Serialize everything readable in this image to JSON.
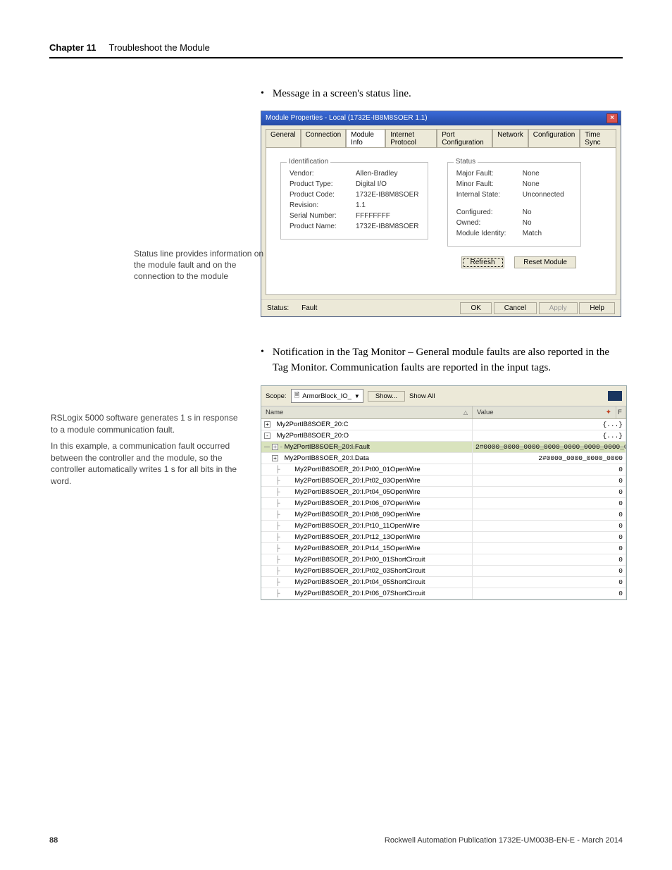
{
  "header": {
    "chapter": "Chapter 11",
    "title": "Troubleshoot the Module"
  },
  "bullets": {
    "b1": "Message in a screen's status line.",
    "b2": "Notification in the Tag Monitor – General module faults are also reported in the Tag Monitor. Communication faults are reported in the input tags."
  },
  "callouts": {
    "c1": "Status line provides information on the module fault and on the connection to the module",
    "c2a": "RSLogix 5000 software generates 1 s in response to a module communication fault.",
    "c2b": "In this example, a communication fault occurred between the controller and the module, so the controller automatically writes 1 s for all bits in the word."
  },
  "dialog": {
    "title": "Module Properties - Local (1732E-IB8M8SOER 1.1)",
    "tabs": [
      "General",
      "Connection",
      "Module Info",
      "Internet Protocol",
      "Port Configuration",
      "Network",
      "Configuration",
      "Time Sync"
    ],
    "ident": {
      "legend": "Identification",
      "vendor_l": "Vendor:",
      "vendor_v": "Allen-Bradley",
      "ptype_l": "Product Type:",
      "ptype_v": "Digital I/O",
      "pcode_l": "Product Code:",
      "pcode_v": "1732E-IB8M8SOER",
      "rev_l": "Revision:",
      "rev_v": "1.1",
      "ser_l": "Serial Number:",
      "ser_v": "FFFFFFFF",
      "pname_l": "Product Name:",
      "pname_v": "1732E-IB8M8SOER"
    },
    "status": {
      "legend": "Status",
      "maj_l": "Major Fault:",
      "maj_v": "None",
      "min_l": "Minor Fault:",
      "min_v": "None",
      "int_l": "Internal State:",
      "int_v": "Unconnected",
      "cfg_l": "Configured:",
      "cfg_v": "No",
      "own_l": "Owned:",
      "own_v": "No",
      "mid_l": "Module Identity:",
      "mid_v": "Match"
    },
    "refresh": "Refresh",
    "reset": "Reset Module",
    "status_l": "Status:",
    "status_v": "Fault",
    "ok": "OK",
    "cancel": "Cancel",
    "apply": "Apply",
    "help": "Help"
  },
  "tagmon": {
    "scope_l": "Scope:",
    "scope_v": "ArmorBlock_IO_",
    "show_btn": "Show...",
    "show_all": "Show All",
    "col_name": "Name",
    "col_value": "Value",
    "rows": [
      {
        "ind": 0,
        "exp": "+",
        "name": "My2PortIB8SOER_20:C",
        "val": "{...}"
      },
      {
        "ind": 0,
        "exp": "-",
        "name": "My2PortIB8SOER_20:O",
        "val": "{...}"
      },
      {
        "ind": 1,
        "exp": "+",
        "name": "My2PortIB8SOER_20:I.Fault",
        "val": "2#0000_0000_0000_0000_0000_0000_0000_0000",
        "hl": true,
        "strike": true
      },
      {
        "ind": 1,
        "exp": "+",
        "name": "My2PortIB8SOER_20:I.Data",
        "val": "2#0000_0000_0000_0000"
      },
      {
        "ind": 2,
        "exp": "",
        "name": "My2PortIB8SOER_20:I.Pt00_01OpenWire",
        "val": "0"
      },
      {
        "ind": 2,
        "exp": "",
        "name": "My2PortIB8SOER_20:I.Pt02_03OpenWire",
        "val": "0"
      },
      {
        "ind": 2,
        "exp": "",
        "name": "My2PortIB8SOER_20:I.Pt04_05OpenWire",
        "val": "0"
      },
      {
        "ind": 2,
        "exp": "",
        "name": "My2PortIB8SOER_20:I.Pt06_07OpenWire",
        "val": "0"
      },
      {
        "ind": 2,
        "exp": "",
        "name": "My2PortIB8SOER_20:I.Pt08_09OpenWire",
        "val": "0"
      },
      {
        "ind": 2,
        "exp": "",
        "name": "My2PortIB8SOER_20:I.Pt10_11OpenWire",
        "val": "0"
      },
      {
        "ind": 2,
        "exp": "",
        "name": "My2PortIB8SOER_20:I.Pt12_13OpenWire",
        "val": "0"
      },
      {
        "ind": 2,
        "exp": "",
        "name": "My2PortIB8SOER_20:I.Pt14_15OpenWire",
        "val": "0"
      },
      {
        "ind": 2,
        "exp": "",
        "name": "My2PortIB8SOER_20:I.Pt00_01ShortCircuit",
        "val": "0"
      },
      {
        "ind": 2,
        "exp": "",
        "name": "My2PortIB8SOER_20:I.Pt02_03ShortCircuit",
        "val": "0"
      },
      {
        "ind": 2,
        "exp": "",
        "name": "My2PortIB8SOER_20:I.Pt04_05ShortCircuit",
        "val": "0"
      },
      {
        "ind": 2,
        "exp": "",
        "name": "My2PortIB8SOER_20:I.Pt06_07ShortCircuit",
        "val": "0"
      }
    ]
  },
  "footer": {
    "page": "88",
    "pub": "Rockwell Automation Publication 1732E-UM003B-EN-E - March 2014"
  }
}
